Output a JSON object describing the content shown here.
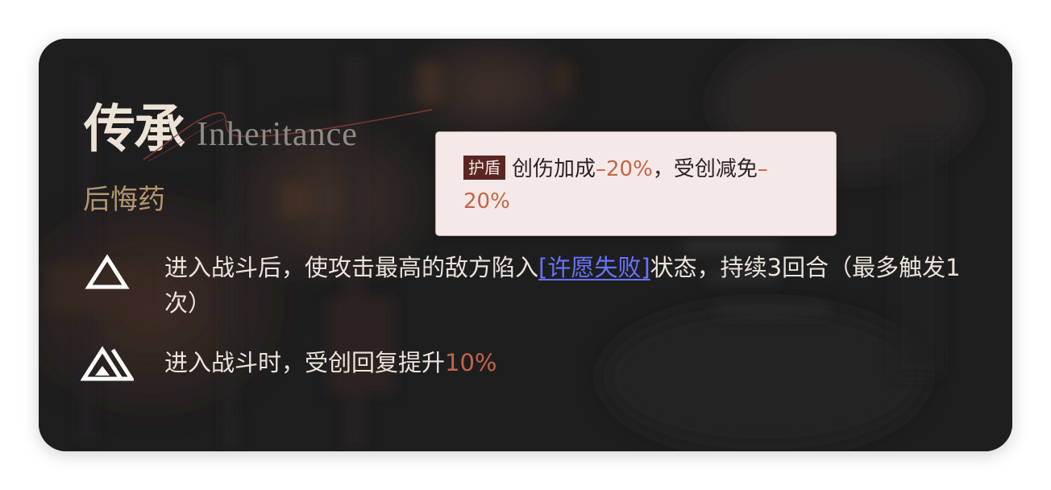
{
  "card": {
    "title_zh": "传承",
    "title_en": "Inheritance",
    "subtitle": "后悔药"
  },
  "skills": [
    {
      "icon": "triangle-outline-icon",
      "text_before": "进入战斗后，使攻击最高的敌方陷入",
      "keyword": "[许愿失败]",
      "text_after": "状态，持续3回合（最多触发1次）"
    },
    {
      "icon": "double-triangle-icon",
      "text_before": "进入战斗时，受创回复提升",
      "value": "10%"
    }
  ],
  "tooltip": {
    "tag": "护盾",
    "text_1": "创伤加成",
    "value_1": "–20%",
    "text_2": "，受创减免",
    "value_2": "–20%"
  },
  "colors": {
    "card_bg": "#1f1e1f",
    "title": "#ece3d6",
    "subtitle": "#b39670",
    "keyword_link": "#6674ff",
    "value_red": "#c46448",
    "tooltip_bg": "#f4e9e7",
    "tag_bg": "#5a2622"
  }
}
